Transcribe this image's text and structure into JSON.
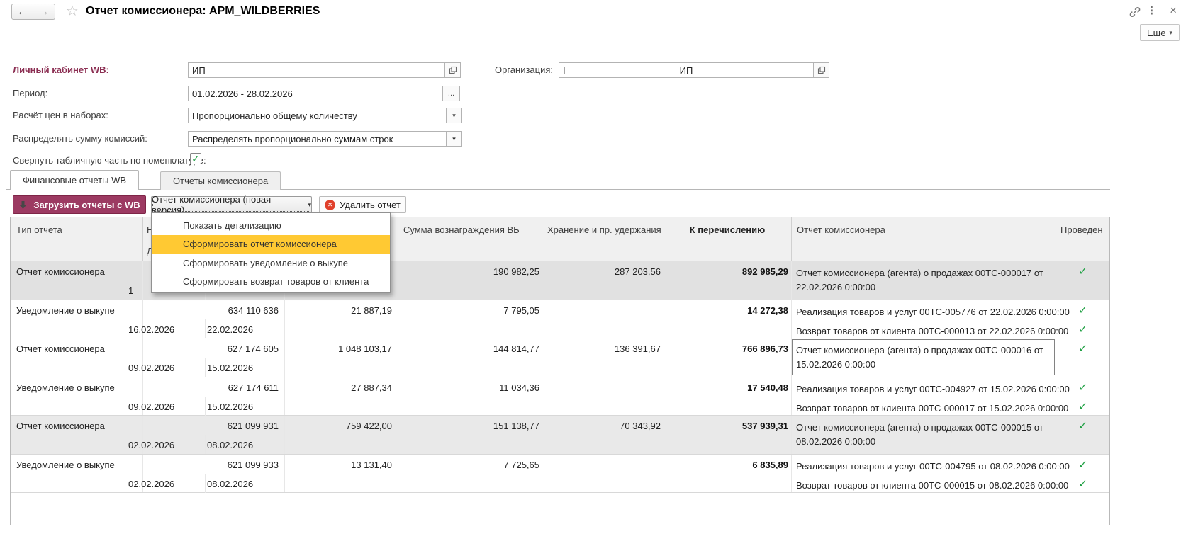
{
  "icons": {
    "back": "←",
    "forward": "→",
    "star": "☆",
    "kebab": "⋮",
    "close": "×",
    "dropdown_arrow": "▾",
    "ellipsis": "...",
    "check": "✓",
    "delete_x": "✕"
  },
  "colors": {
    "accent_maroon": "#9c3a62",
    "required_label": "#8b2e52",
    "menu_highlight": "#ffc933",
    "posted_green": "#1fa043",
    "delete_red": "#e0402b"
  },
  "titlebar": {
    "title": "Отчет комиссионера: APM_WILDBERRIES"
  },
  "commands": {
    "more": "Еще"
  },
  "form": {
    "wb_account": {
      "label": "Личный кабинет WB:",
      "value": "ИП"
    },
    "organization": {
      "label": "Организация:",
      "value_start": "I",
      "value_mid": "ИП"
    },
    "period": {
      "label": "Период:",
      "value": "01.02.2026 - 28.02.2026"
    },
    "set_prices": {
      "label": "Расчёт цен в наборах:",
      "value": "Пропорционально общему количеству"
    },
    "distribute": {
      "label": "Распределять сумму комиссий:",
      "value": "Распределять пропорционально суммам строк"
    },
    "collapse": {
      "label": "Свернуть табличную часть по номенклатуре:",
      "checked": true
    }
  },
  "tabs": [
    {
      "label": "Финансовые отчеты WB",
      "active": true
    },
    {
      "label": "Отчеты комиссионера",
      "active": false
    }
  ],
  "toolbar": {
    "load": "Загрузить отчеты с WB",
    "report_menu": "Отчет комиссионера (новая версия)",
    "delete": "Удалить отчет"
  },
  "context_menu": {
    "items": [
      "Показать детализацию",
      "Сформировать отчет комиссионера",
      "Сформировать уведомление о выкупе",
      "Сформировать возврат товаров от клиента"
    ],
    "highlighted": "Сформировать отчет комиссионера"
  },
  "table": {
    "headers": {
      "type": "Тип отчета",
      "number_partial": "Н",
      "dates_partial": "Д",
      "reward": "Сумма вознаграждения ВБ",
      "storage": "Хранение и пр. удержания",
      "transfer": "К перечислению",
      "report": "Отчет комиссионера",
      "posted": "Проведен"
    },
    "rows": [
      {
        "type": "Отчет комиссионера",
        "number": "",
        "date_from": "1",
        "date_to": "",
        "sales": "",
        "reward": "190 982,25",
        "storage": "287 203,56",
        "transfer": "892 985,29",
        "docs": [
          {
            "text": "Отчет комиссионера (агента) о продажах 00ТС-000017 от 22.02.2026 0:00:00",
            "posted": true
          }
        ]
      },
      {
        "type": "Уведомление о выкупе",
        "number": "634 110 636",
        "date_from": "16.02.2026",
        "date_to": "22.02.2026",
        "sales": "21 887,19",
        "reward": "7 795,05",
        "storage": "",
        "transfer": "14 272,38",
        "docs": [
          {
            "text": "Реализация товаров и услуг 00ТС-005776 от 22.02.2026 0:00:00",
            "posted": true
          },
          {
            "text": "Возврат товаров от клиента 00ТС-000013 от 22.02.2026 0:00:00",
            "posted": true
          }
        ]
      },
      {
        "type": "Отчет комиссионера",
        "number": "627 174 605",
        "date_from": "09.02.2026",
        "date_to": "15.02.2026",
        "sales": "1 048 103,17",
        "reward": "144 814,77",
        "storage": "136 391,67",
        "transfer": "766 896,73",
        "docs": [
          {
            "text": "Отчет комиссионера (агента) о продажах 00ТС-000016 от 15.02.2026 0:00:00",
            "posted": true
          }
        ],
        "focused_doc": true
      },
      {
        "type": "Уведомление о выкупе",
        "number": "627 174 611",
        "date_from": "09.02.2026",
        "date_to": "15.02.2026",
        "sales": "27 887,34",
        "reward": "11 034,36",
        "storage": "",
        "transfer": "17 540,48",
        "docs": [
          {
            "text": "Реализация товаров и услуг 00ТС-004927 от 15.02.2026 0:00:00",
            "posted": true
          },
          {
            "text": "Возврат товаров от клиента 00ТС-000017 от 15.02.2026 0:00:00",
            "posted": true
          }
        ]
      },
      {
        "type": "Отчет комиссионера",
        "number": "621 099 931",
        "date_from": "02.02.2026",
        "date_to": "08.02.2026",
        "sales": "759 422,00",
        "reward": "151 138,77",
        "storage": "70 343,92",
        "transfer": "537 939,31",
        "docs": [
          {
            "text": "Отчет комиссионера (агента) о продажах 00ТС-000015 от 08.02.2026 0:00:00",
            "posted": true
          }
        ]
      },
      {
        "type": "Уведомление о выкупе",
        "number": "621 099 933",
        "date_from": "02.02.2026",
        "date_to": "08.02.2026",
        "sales": "13 131,40",
        "reward": "7 725,65",
        "storage": "",
        "transfer": "6 835,89",
        "docs": [
          {
            "text": "Реализация товаров и услуг 00ТС-004795 от 08.02.2026 0:00:00",
            "posted": true
          },
          {
            "text": "Возврат товаров от клиента 00ТС-000015 от 08.02.2026 0:00:00",
            "posted": true
          }
        ]
      }
    ]
  }
}
